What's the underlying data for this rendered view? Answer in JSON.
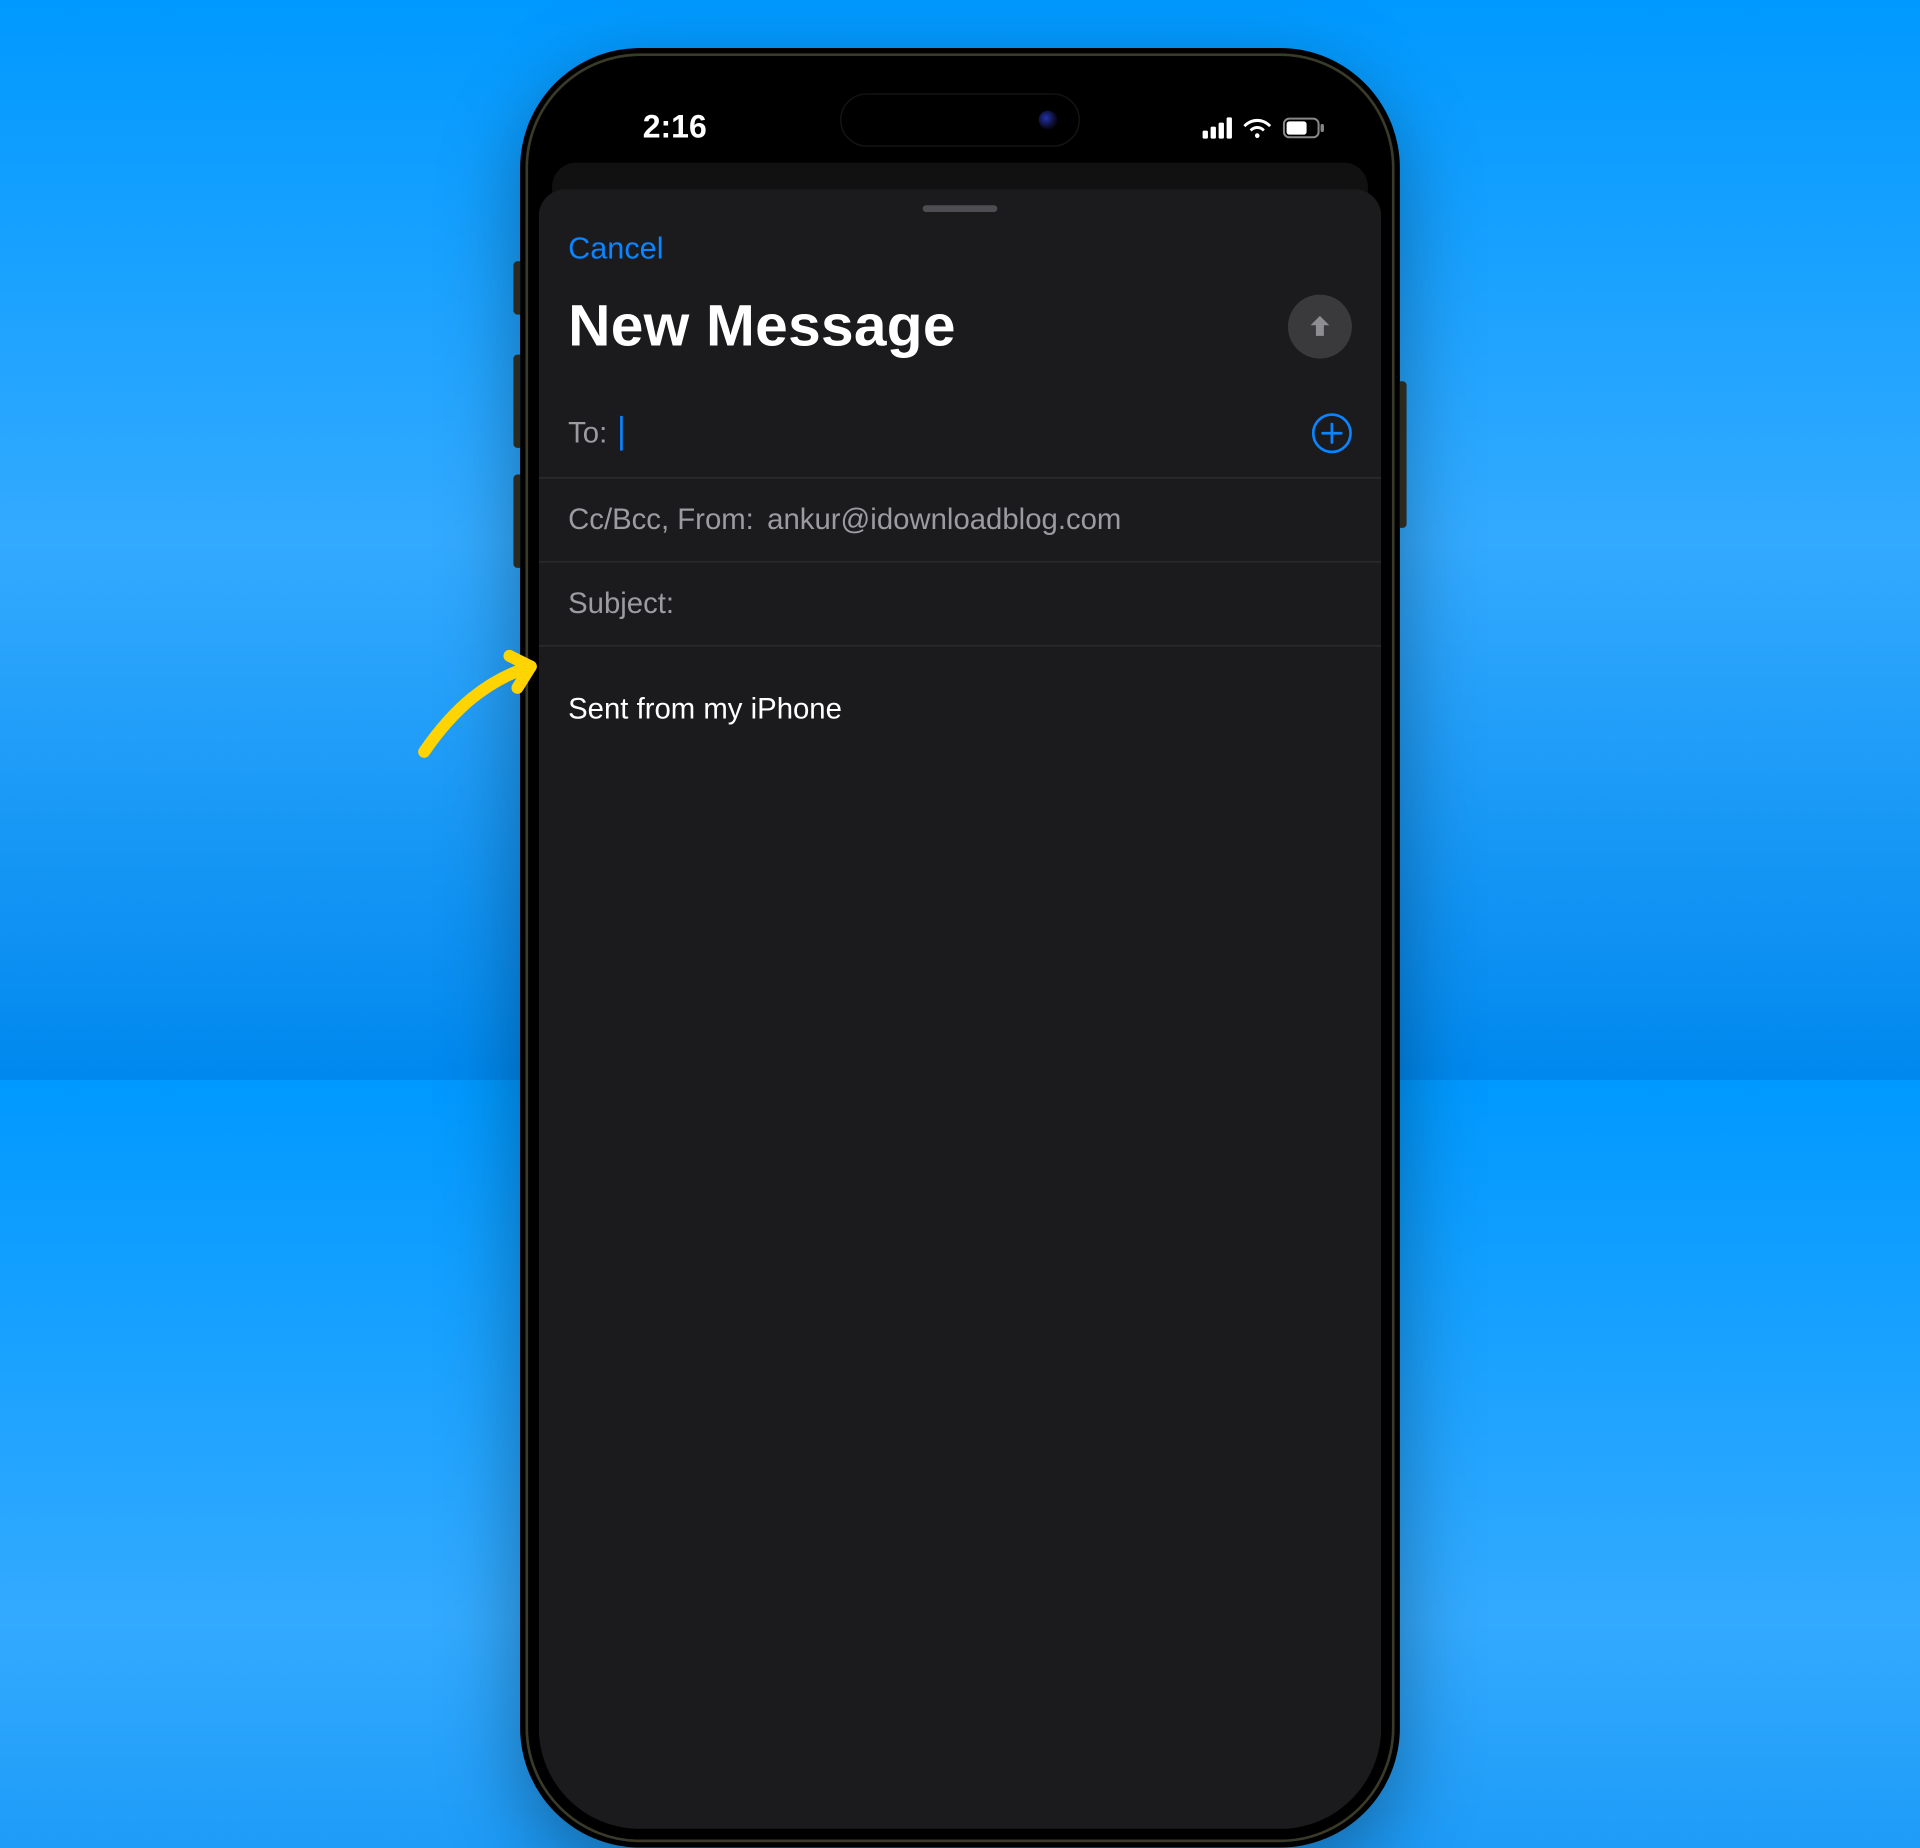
{
  "status": {
    "time": "2:16"
  },
  "sheet": {
    "cancel": "Cancel",
    "title": "New Message",
    "to_label": "To:",
    "ccbcc_label": "Cc/Bcc, From:",
    "from_email": "ankur@idownloadblog.com",
    "subject_label": "Subject:",
    "signature": "Sent from my iPhone"
  },
  "colors": {
    "accent": "#0a84ff",
    "annotation": "#ffd400"
  }
}
